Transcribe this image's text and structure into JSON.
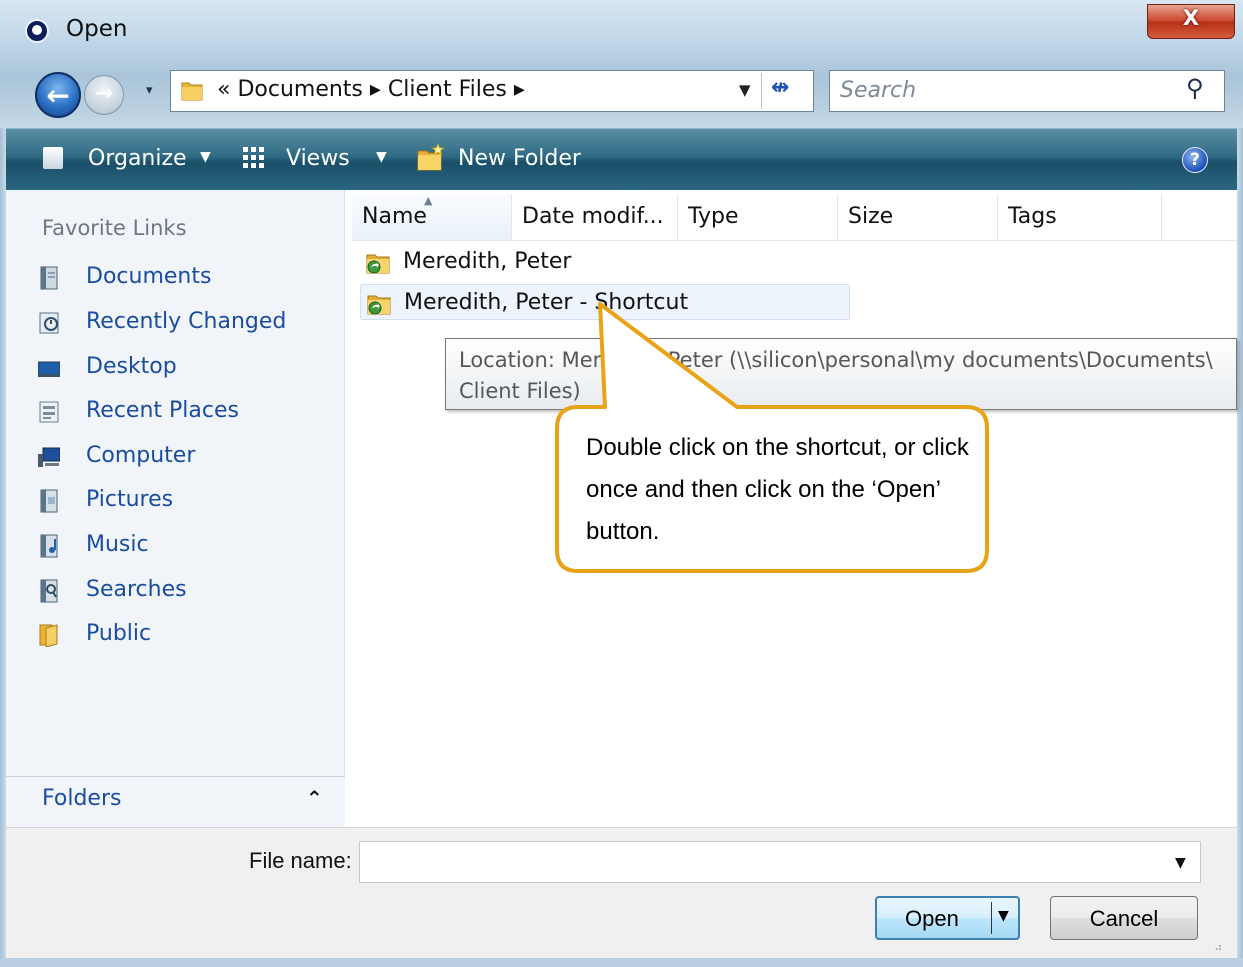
{
  "window": {
    "title": "Open",
    "close_glyph": "X"
  },
  "navigation": {
    "back_glyph": "←",
    "forward_glyph": "→",
    "history_glyph": "▾"
  },
  "address_bar": {
    "path_text": "« Documents ▸ Client Files ▸",
    "dropdown_glyph": "▼",
    "refresh_glyph": "↮"
  },
  "search": {
    "placeholder": "Search",
    "icon_glyph": "⚲"
  },
  "toolbar": {
    "organize_label": "Organize",
    "views_label": "Views",
    "new_folder_label": "New Folder",
    "dropdown_glyph": "▼",
    "help_glyph": "?"
  },
  "nav_pane": {
    "heading": "Favorite Links",
    "items": [
      {
        "label": "Documents",
        "icon": "documents-icon"
      },
      {
        "label": "Recently Changed",
        "icon": "recently-changed-icon"
      },
      {
        "label": "Desktop",
        "icon": "desktop-icon"
      },
      {
        "label": "Recent Places",
        "icon": "recent-places-icon"
      },
      {
        "label": "Computer",
        "icon": "computer-icon"
      },
      {
        "label": "Pictures",
        "icon": "pictures-icon"
      },
      {
        "label": "Music",
        "icon": "music-icon"
      },
      {
        "label": "Searches",
        "icon": "searches-icon"
      },
      {
        "label": "Public",
        "icon": "public-folder-icon"
      }
    ],
    "folders_label": "Folders",
    "folders_chevron": "⌃"
  },
  "file_list": {
    "columns": [
      "Name",
      "Date modif...",
      "Type",
      "Size",
      "Tags"
    ],
    "sort_glyph": "▲",
    "rows": [
      {
        "name": "Meredith, Peter",
        "icon": "shortcut-folder-icon"
      },
      {
        "name": "Meredith, Peter - Shortcut",
        "icon": "shortcut-folder-icon"
      }
    ],
    "tooltip": "Location: Meredith, Peter (\\\\silicon\\personal\\my documents\\Documents\\\nClient Files)"
  },
  "callout": {
    "text": "Double click on the shortcut, or click once and then click on the ‘Open’ button.",
    "border_color": "#e8a317"
  },
  "bottom": {
    "file_name_label": "File name:",
    "file_name_value": "",
    "dropdown_glyph": "▼",
    "open_label": "Open",
    "cancel_label": "Cancel",
    "grip_glyph": "⠴"
  }
}
